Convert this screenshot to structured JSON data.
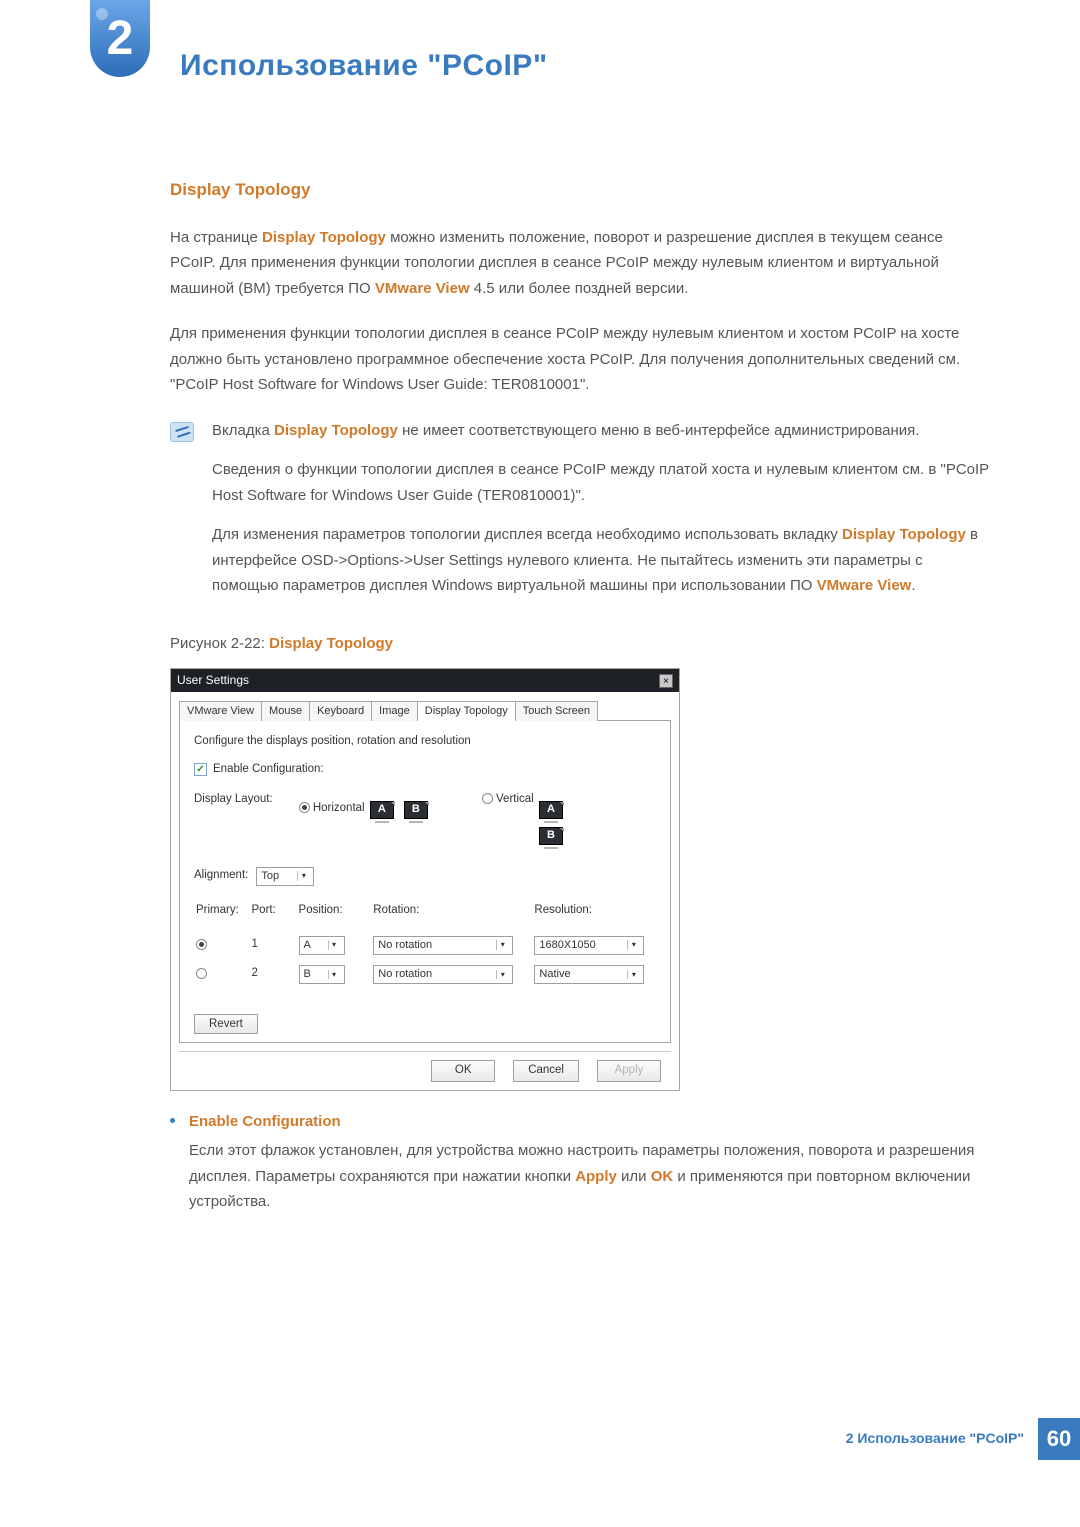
{
  "chapter": {
    "number": "2",
    "title": "Использование \"PCoIP\""
  },
  "section": {
    "heading": "Display Topology"
  },
  "p1": {
    "pre": "На странице ",
    "b1": "Display Topology",
    "mid": " можно изменить положение, поворот и разрешение дисплея в текущем сеансе PCoIP. Для применения функции топологии дисплея в сеансе PCoIP между нулевым клиентом и виртуальной машиной (ВМ) требуется ПО ",
    "b2": "VMware View",
    "post": " 4.5 или более поздней версии."
  },
  "p2": "Для применения функции топологии дисплея в сеансе PCoIP между нулевым клиентом и хостом PCoIP на хосте должно быть установлено программное обеспечение хоста PCoIP. Для получения дополнительных сведений см. \"PCoIP Host Software for Windows User Guide: TER0810001\".",
  "info": {
    "i1": {
      "pre": "Вкладка ",
      "b1": "Display Topology",
      "post": " не имеет соответствующего меню в веб-интерфейсе администрирования."
    },
    "i2": "Сведения о функции топологии дисплея в сеансе PCoIP между платой хоста и нулевым клиентом см. в \"PCoIP Host Software for Windows User Guide (TER0810001)\".",
    "i3": {
      "pre": "Для изменения параметров топологии дисплея всегда необходимо использовать вкладку ",
      "b1": "Display Topology",
      "mid": " в интерфейсе OSD->Options->User Settings нулевого клиента. Не пытайтесь изменить эти параметры с помощью параметров дисплея Windows виртуальной машины при использовании ПО ",
      "b2": "VMware View",
      "post": "."
    }
  },
  "figure": {
    "pre": "Рисунок 2-22: ",
    "name": "Display Topology"
  },
  "ss": {
    "title": "User Settings",
    "tabs": [
      "VMware View",
      "Mouse",
      "Keyboard",
      "Image",
      "Display Topology",
      "Touch Screen"
    ],
    "active_tab_index": 4,
    "instruction": "Configure the displays position, rotation and resolution",
    "enable_label": "Enable Configuration:",
    "enable_checked": true,
    "layout_label": "Display Layout:",
    "layout_options": {
      "horizontal": "Horizontal",
      "vertical": "Vertical"
    },
    "mon_labels": {
      "a": "A",
      "b": "B"
    },
    "alignment_label": "Alignment:",
    "alignment_value": "Top",
    "columns": {
      "primary": "Primary:",
      "port": "Port:",
      "position": "Position:",
      "rotation": "Rotation:",
      "resolution": "Resolution:"
    },
    "rows": [
      {
        "primary": true,
        "port": "1",
        "position": "A",
        "rotation": "No rotation",
        "resolution": "1680X1050"
      },
      {
        "primary": false,
        "port": "2",
        "position": "B",
        "rotation": "No rotation",
        "resolution": "Native"
      }
    ],
    "revert": "Revert",
    "buttons": {
      "ok": "OK",
      "cancel": "Cancel",
      "apply": "Apply"
    }
  },
  "bullet": {
    "title": "Enable Configuration",
    "body": {
      "pre": "Если этот флажок установлен, для устройства можно настроить параметры положения, поворота и разрешения дисплея. Параметры сохраняются при нажатии кнопки ",
      "b1": "Apply",
      "mid": " или ",
      "b2": "OK",
      "post": " и применяются при повторном включении устройства."
    }
  },
  "footer": {
    "text": "2 Использование \"PCoIP\"",
    "page": "60"
  }
}
